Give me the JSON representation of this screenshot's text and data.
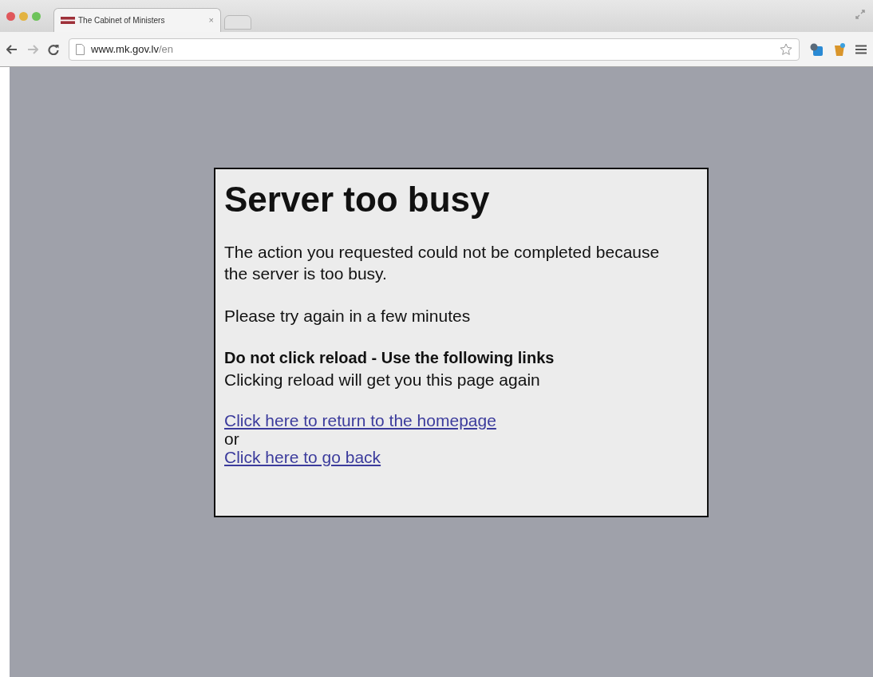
{
  "window": {
    "tab_title": "The Cabinet of Ministers",
    "tab_close": "×",
    "url_host": "www.mk.gov.lv",
    "url_path": "/en"
  },
  "page": {
    "heading": "Server too busy",
    "message": "The action you requested could not be completed because the server is too busy.",
    "retry": "Please try again in a few minutes",
    "warning": "Do not click reload - Use the following links",
    "warning_note": "Clicking reload will get you this page again",
    "links": [
      {
        "kind": "link",
        "text": "Click here to return to the homepage"
      },
      {
        "kind": "text",
        "text": "or"
      },
      {
        "kind": "link",
        "text": "Click here to go back"
      }
    ]
  }
}
